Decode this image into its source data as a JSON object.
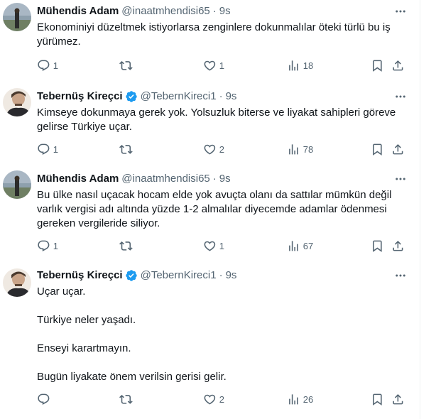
{
  "tweets": [
    {
      "name": "Mühendis Adam",
      "handle": "@inaatmhendisi65",
      "time": "9s",
      "verified": false,
      "text": [
        "Ekonominiyi düzeltmek istiyorlarsa zenginlere dokunmalılar öteki türlü  bu iş yürümez."
      ],
      "replies": "1",
      "reposts": "",
      "likes": "1",
      "views": "18"
    },
    {
      "name": "Tebernüş Kireçci",
      "handle": "@TebernKireci1",
      "time": "9s",
      "verified": true,
      "text": [
        "Kimseye dokunmaya gerek yok. Yolsuzluk biterse ve liyakat sahipleri göreve gelirse Türkiye uçar."
      ],
      "replies": "1",
      "reposts": "",
      "likes": "2",
      "views": "78"
    },
    {
      "name": "Mühendis Adam",
      "handle": "@inaatmhendisi65",
      "time": "9s",
      "verified": false,
      "text": [
        "Bu ülke nasıl uçacak hocam elde yok avuçta olanı da sattılar mümkün değil varlık vergisi adı altında yüzde 1-2 almalılar diyecemde adamlar ödenmesi gereken vergileride siliyor."
      ],
      "replies": "1",
      "reposts": "",
      "likes": "1",
      "views": "67"
    },
    {
      "name": "Tebernüş Kireçci",
      "handle": "@TebernKireci1",
      "time": "9s",
      "verified": true,
      "text": [
        "Uçar uçar.",
        "Türkiye neler yaşadı.",
        "Enseyi karartmayın.",
        "Bugün liyakate önem verilsin gerisi gelir."
      ],
      "replies": "",
      "reposts": "",
      "likes": "2",
      "views": "26"
    }
  ],
  "icons": {
    "more": "more-horizontal-icon",
    "reply": "reply-icon",
    "repost": "repost-icon",
    "like": "like-icon",
    "views": "views-icon",
    "bookmark": "bookmark-icon",
    "share": "share-icon",
    "verified": "verified-badge-icon"
  },
  "colors": {
    "text": "#0f1419",
    "secondary": "#536471",
    "verified": "#1d9bf0",
    "border": "#eff3f4"
  }
}
